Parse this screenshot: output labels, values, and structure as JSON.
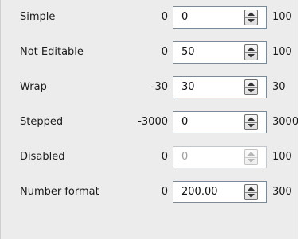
{
  "rows": [
    {
      "label": "Simple",
      "min": "0",
      "value": "0",
      "max": "100",
      "disabled": false
    },
    {
      "label": "Not Editable",
      "min": "0",
      "value": "50",
      "max": "100",
      "disabled": false
    },
    {
      "label": "Wrap",
      "min": "-30",
      "value": "30",
      "max": "30",
      "disabled": false
    },
    {
      "label": "Stepped",
      "min": "-3000",
      "value": "0",
      "max": "3000",
      "disabled": false
    },
    {
      "label": "Disabled",
      "min": "0",
      "value": "0",
      "max": "100",
      "disabled": true
    },
    {
      "label": "Number format",
      "min": "0",
      "value": "200.00",
      "max": "300",
      "disabled": false
    }
  ],
  "icons": {
    "up": "spin-up-arrow-icon",
    "down": "spin-down-arrow-icon"
  },
  "colors": {
    "panel_background": "#ececec",
    "field_border": "#7a8a99",
    "disabled_text": "#a0a0a0"
  }
}
